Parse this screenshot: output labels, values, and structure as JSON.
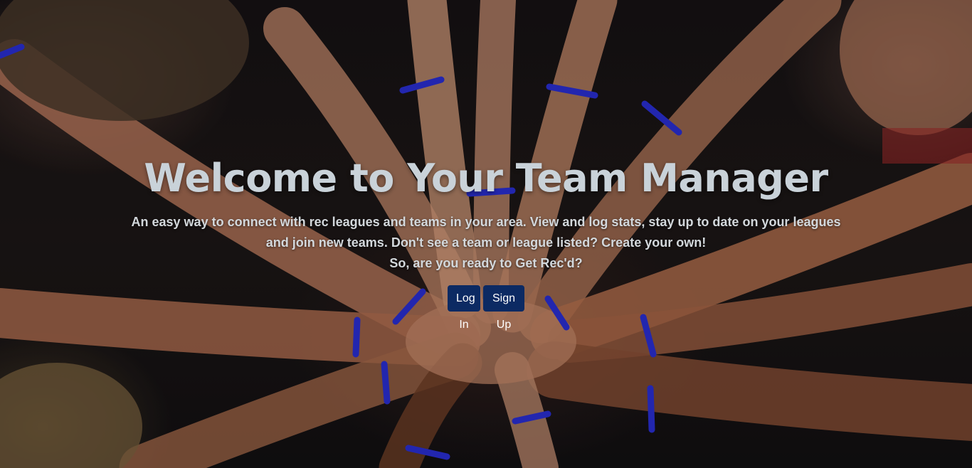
{
  "hero": {
    "title": "Welcome to Your Team Manager",
    "description": "An easy way to connect with rec leagues and teams in your area. View and log stats, stay up to date on your leagues and join new teams. Don't see a team or league listed? Create your own!",
    "tagline": "So, are you ready to Get Rec'd?",
    "background_image": "hands-together-team-photo"
  },
  "buttons": {
    "login_label": "Log In",
    "signup_label": "Sign Up",
    "color": "#0c2a63"
  },
  "colors": {
    "title": "#c9d2d9",
    "text": "#d3d8dc",
    "wristband": "#2a2fd6"
  }
}
